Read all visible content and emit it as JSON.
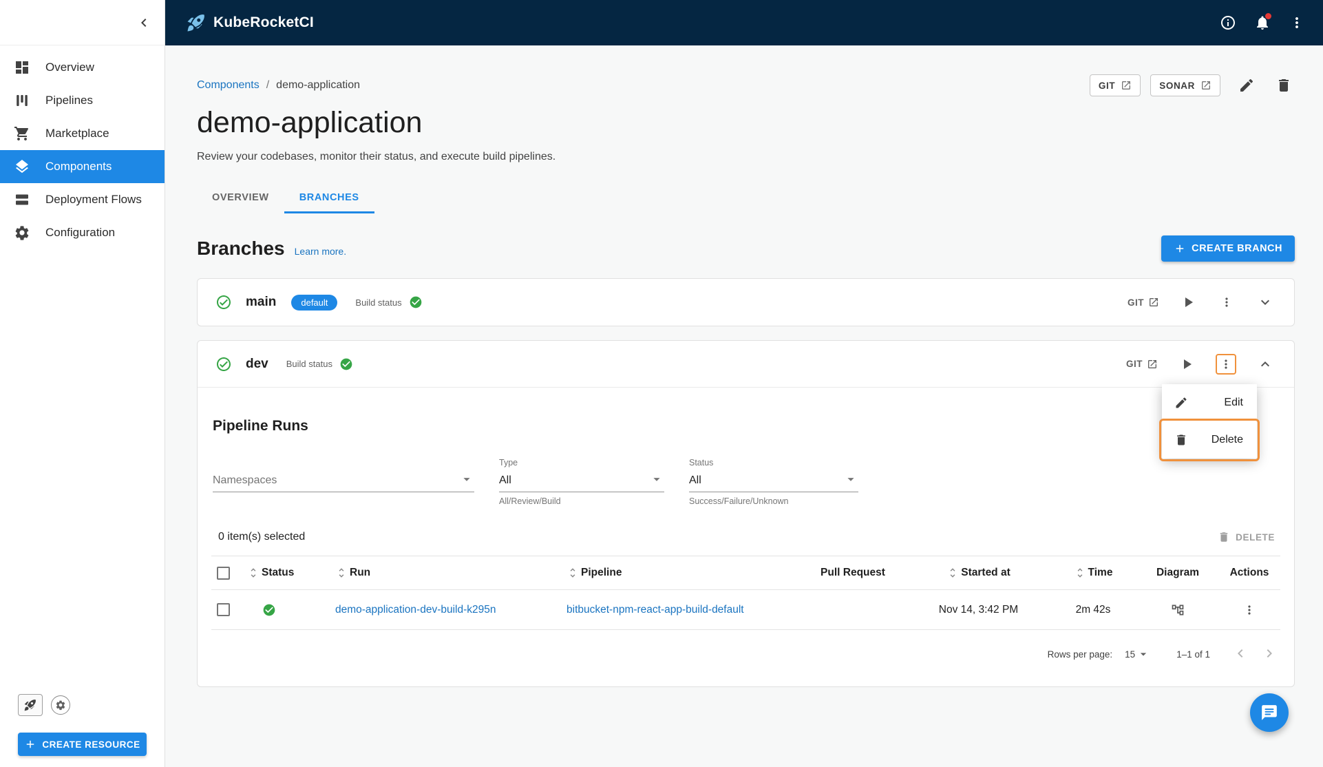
{
  "app": {
    "title": "KubeRocketCI"
  },
  "sidebar": {
    "items": [
      {
        "label": "Overview",
        "icon": "dashboard-icon"
      },
      {
        "label": "Pipelines",
        "icon": "pipelines-icon"
      },
      {
        "label": "Marketplace",
        "icon": "cart-icon"
      },
      {
        "label": "Components",
        "icon": "layers-icon",
        "active": true
      },
      {
        "label": "Deployment Flows",
        "icon": "rows-icon"
      },
      {
        "label": "Configuration",
        "icon": "gear-icon"
      }
    ],
    "create_resource_label": "CREATE RESOURCE"
  },
  "breadcrumb": {
    "root": "Components",
    "separator": "/",
    "current": "demo-application"
  },
  "header_actions": {
    "git_label": "GIT",
    "sonar_label": "SONAR"
  },
  "page": {
    "title": "demo-application",
    "description": "Review your codebases, monitor their status, and execute build pipelines."
  },
  "tabs": [
    {
      "label": "OVERVIEW",
      "active": false
    },
    {
      "label": "BRANCHES",
      "active": true
    }
  ],
  "branches_section": {
    "title": "Branches",
    "learn_more": "Learn more.",
    "create_branch_label": "CREATE BRANCH"
  },
  "branches": [
    {
      "name": "main",
      "default_chip": "default",
      "build_status_label": "Build status",
      "git_label": "GIT",
      "expanded": false
    },
    {
      "name": "dev",
      "build_status_label": "Build status",
      "git_label": "GIT",
      "expanded": true
    }
  ],
  "context_menu": {
    "items": [
      {
        "label": "Edit",
        "icon": "pencil-icon"
      },
      {
        "label": "Delete",
        "icon": "trash-icon",
        "highlighted": true
      }
    ]
  },
  "pipeline_runs": {
    "title": "Pipeline Runs",
    "filters": {
      "namespaces": {
        "label": "Namespaces"
      },
      "type": {
        "label": "Type",
        "value": "All",
        "helper": "All/Review/Build"
      },
      "status": {
        "label": "Status",
        "value": "All",
        "helper": "Success/Failure/Unknown"
      }
    },
    "selected_text": "0 item(s) selected",
    "delete_label": "DELETE",
    "table": {
      "columns": [
        "Status",
        "Run",
        "Pipeline",
        "Pull Request",
        "Started at",
        "Time",
        "Diagram",
        "Actions"
      ],
      "rows": [
        {
          "status": "success",
          "run": "demo-application-dev-build-k295n",
          "pipeline": "bitbucket-npm-react-app-build-default",
          "pull_request": "",
          "started_at": "Nov 14, 3:42 PM",
          "time": "2m 42s"
        }
      ]
    },
    "pagination": {
      "rows_per_page_label": "Rows per page:",
      "rows_per_page_value": "15",
      "range": "1–1 of 1"
    }
  },
  "colors": {
    "app_bar": "#052642",
    "accent": "#1e88e5",
    "link": "#1a74c0",
    "success": "#36a546",
    "highlight_outline": "#f0913c"
  }
}
